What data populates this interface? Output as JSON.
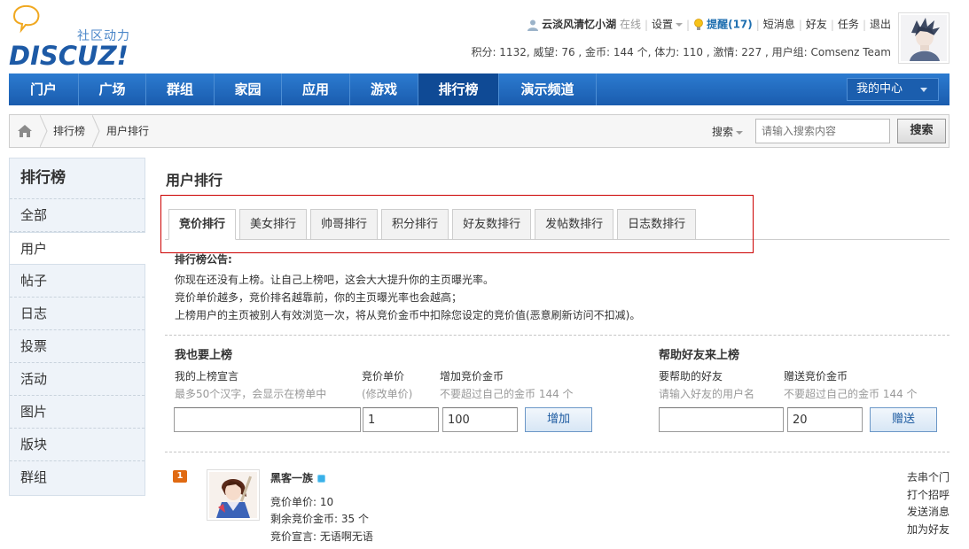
{
  "logo": {
    "subtitle": "社区动力",
    "brand": "DISCUZ!"
  },
  "user_menu": {
    "username": "云淡风清忆小湖",
    "status": "在线",
    "settings": "设置",
    "remind": "提醒(17)",
    "messages": "短消息",
    "friends": "好友",
    "tasks": "任务",
    "logout": "退出"
  },
  "stats": "积分: 1132, 威望: 76 , 金币: 144 个, 体力: 110 , 激情: 227 , 用户组: Comsenz Team",
  "nav": {
    "items": [
      {
        "label": "门户"
      },
      {
        "label": "广场"
      },
      {
        "label": "群组"
      },
      {
        "label": "家园"
      },
      {
        "label": "应用"
      },
      {
        "label": "游戏"
      },
      {
        "label": "排行榜"
      },
      {
        "label": "演示频道"
      }
    ],
    "active_index": 6,
    "my_center": "我的中心"
  },
  "breadcrumb": {
    "items": [
      "排行榜",
      "用户排行"
    ]
  },
  "search": {
    "label": "搜索",
    "placeholder": "请输入搜索内容",
    "button": "搜索"
  },
  "sidebar": {
    "title": "排行榜",
    "items": [
      "全部",
      "用户",
      "帖子",
      "日志",
      "投票",
      "活动",
      "图片",
      "版块",
      "群组"
    ],
    "active_index": 1
  },
  "main": {
    "title": "用户排行",
    "tabs": [
      "竞价排行",
      "美女排行",
      "帅哥排行",
      "积分排行",
      "好友数排行",
      "发帖数排行",
      "日志数排行"
    ],
    "active_tab": 0
  },
  "notice": {
    "title": "排行榜公告:",
    "lines": [
      "你现在还没有上榜。让自己上榜吧，这会大大提升你的主页曝光率。",
      "竞价单价越多，竞价排名越靠前，你的主页曝光率也会越高；",
      "上榜用户的主页被别人有效浏览一次，将从竞价金币中扣除您设定的竞价值(恶意刷新访问不扣减)。"
    ]
  },
  "self_form": {
    "heading": "我也要上榜",
    "slogan_label": "我的上榜宣言",
    "slogan_hint": "最多50个汉字，会显示在榜单中",
    "slogan_value": "",
    "price_label": "竞价单价",
    "price_hint": "(修改单价)",
    "price_value": "1",
    "coins_label": "增加竞价金币",
    "coins_hint": "不要超过自己的金币 144 个",
    "coins_value": "100",
    "button": "增加"
  },
  "friend_form": {
    "heading": "帮助好友来上榜",
    "friend_label": "要帮助的好友",
    "friend_hint": "请输入好友的用户名",
    "friend_value": "",
    "gift_label": "赠送竞价金币",
    "gift_hint": "不要超过自己的金币 144 个",
    "gift_value": "20",
    "button": "赠送"
  },
  "entries": [
    {
      "rank": "1",
      "name": "黑客一族",
      "price": "竞价单价: 10",
      "remaining": "剩余竞价金币: 35 个",
      "slogan": "竞价宣言: 无语啊无语",
      "actions": [
        "去串个门",
        "打个招呼",
        "发送消息",
        "加为好友"
      ]
    }
  ],
  "colors": {
    "nav_bg": "#1a5cae",
    "nav_active": "#0f4a95",
    "highlight_box": "#cc0000",
    "rank_badge": "#e06a12"
  }
}
